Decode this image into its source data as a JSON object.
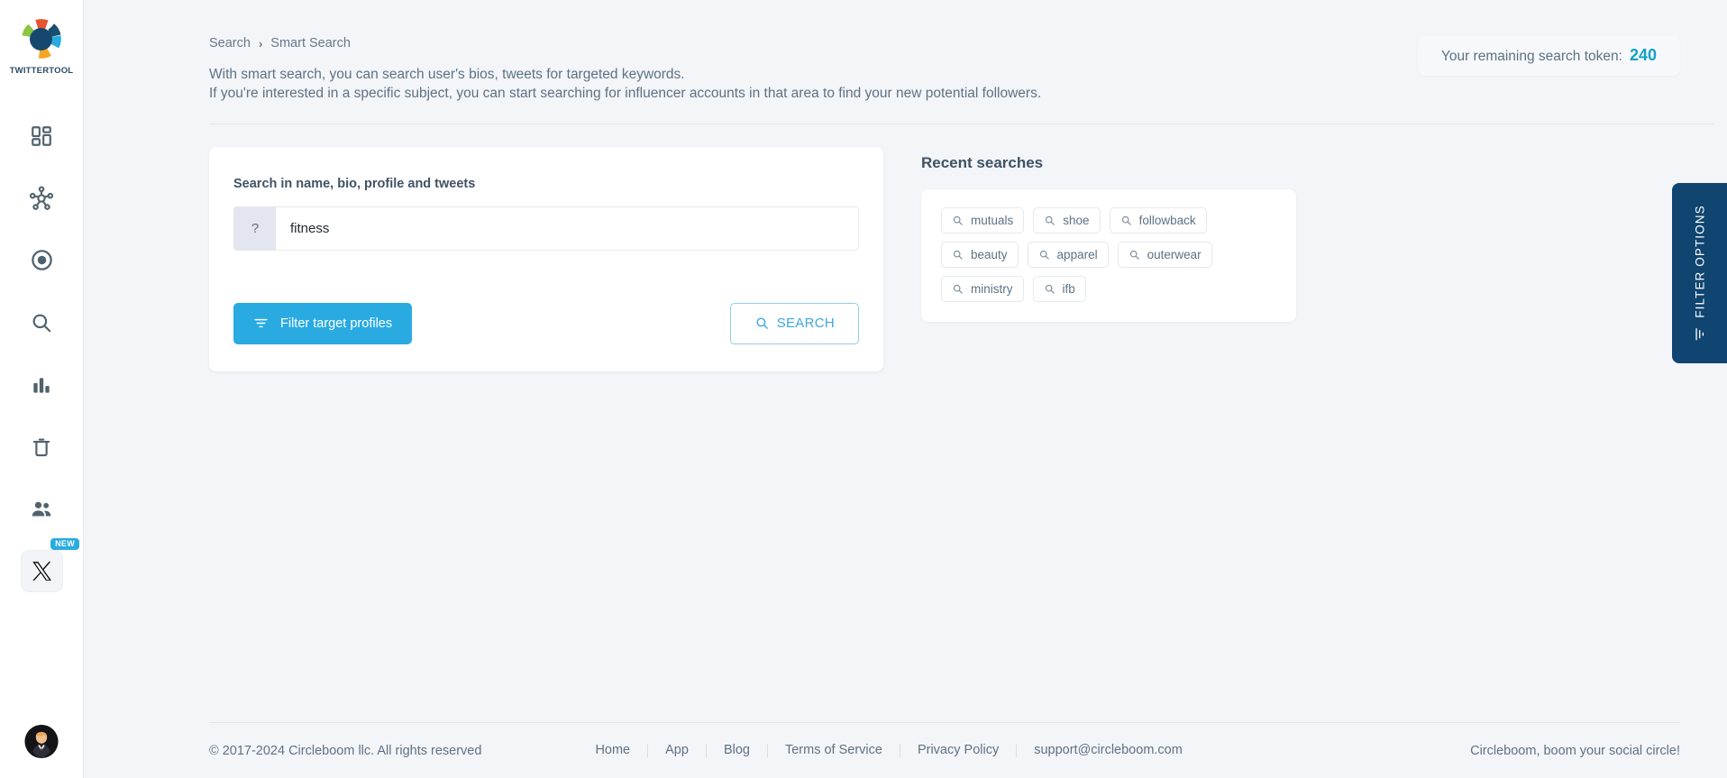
{
  "brand": {
    "name": "TWITTERTOOL"
  },
  "sidebar": {
    "items": [
      {
        "icon": "dashboard-grid-icon",
        "name": "dashboard"
      },
      {
        "icon": "network-hub-icon",
        "name": "network"
      },
      {
        "icon": "circle-target-icon",
        "name": "target"
      },
      {
        "icon": "search-icon",
        "name": "search"
      },
      {
        "icon": "bar-chart-icon",
        "name": "analytics"
      },
      {
        "icon": "trash-icon",
        "name": "delete"
      },
      {
        "icon": "users-icon",
        "name": "users"
      }
    ],
    "x_item": {
      "icon": "x-logo-icon",
      "badge": "NEW"
    },
    "avatar": {
      "icon": "avatar-icon"
    }
  },
  "breadcrumb": {
    "root": "Search",
    "separator": "›",
    "current": "Smart Search"
  },
  "intro": {
    "line1": "With smart search, you can search user's bios, tweets for targeted keywords.",
    "line2": "If you're interested in a specific subject, you can start searching for influencer accounts in that area to find your new potential followers."
  },
  "token": {
    "label": "Your remaining search token:",
    "value": "240"
  },
  "search_card": {
    "label": "Search in name, bio, profile and tweets",
    "addon": "?",
    "value": "fitness",
    "placeholder": "",
    "filter_button": "Filter target profiles",
    "search_button": "SEARCH"
  },
  "recent": {
    "title": "Recent searches",
    "chips": [
      "mutuals",
      "shoe",
      "followback",
      "beauty",
      "apparel",
      "outerwear",
      "ministry",
      "ifb"
    ]
  },
  "filter_tab": {
    "label": "FILTER OPTIONS"
  },
  "footer": {
    "copyright": "© 2017-2024 Circleboom llc. All rights reserved",
    "links": [
      "Home",
      "App",
      "Blog",
      "Terms of Service",
      "Privacy Policy",
      "support@circleboom.com"
    ],
    "tagline": "Circleboom, boom your social circle!"
  },
  "colors": {
    "accent_blue": "#29abe2",
    "token_teal": "#0fa3c6",
    "navy": "#0f4570",
    "slate": "#50626e",
    "page_bg": "#f4f5f9"
  }
}
